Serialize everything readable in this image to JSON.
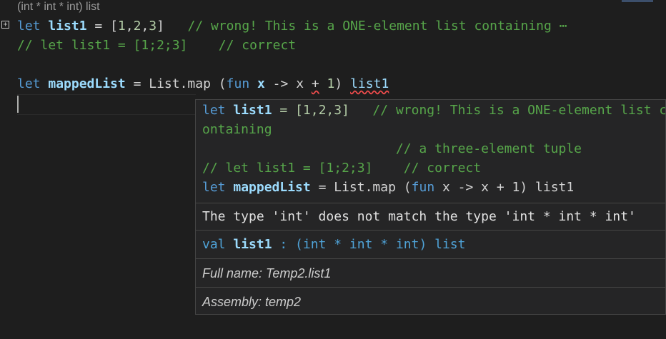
{
  "codelens": "(int * int * int) list",
  "editor": {
    "line1": {
      "kw": "let",
      "name": "list1",
      "eq": " = ",
      "bracket_open": "[",
      "n1": "1",
      "c1": ",",
      "n2": "2",
      "c2": ",",
      "n3": "3",
      "bracket_close": "]",
      "comment": "   // wrong! This is a ONE-element list containing",
      "ellipsis": " ⋯"
    },
    "line2": {
      "comment": "// let list1 = [1;2;3]    // correct"
    },
    "line4": {
      "kw": "let",
      "name": "mappedList",
      "eq": " = ",
      "fn": "List.map",
      "paren_open": " (",
      "fun_kw": "fun",
      "x1": " x ",
      "arrow": "->",
      "x2": " x ",
      "plus": "+",
      "one": " 1",
      "paren_close": ") ",
      "ref": "list1"
    }
  },
  "tooltip": {
    "code": {
      "line1_kw": "let",
      "line1_name": "list1",
      "line1_rest": " = [1,2,3]",
      "line1_comment": "   // wrong! This is a ONE-element list c",
      "line2": "ontaining",
      "line3": "                         // a three-element tuple",
      "line4": "// let list1 = [1;2;3]    // correct",
      "line5_kw": "let",
      "line5_name": "mappedList",
      "line5_eq": " = ",
      "line5_fn": "List.map",
      "line5_open": " (",
      "line5_fun": "fun",
      "line5_rest": " x -> x + 1) list1"
    },
    "error": "The type 'int' does not match the type 'int * int * int'",
    "signature": {
      "kw": "val",
      "name": "list1",
      "rest": " : (int * int * int) list"
    },
    "full_name": "Full name: Temp2.list1",
    "assembly": "Assembly: temp2"
  },
  "colors": {
    "background": "#1e1e1e",
    "keyword": "#569cd6",
    "comment": "#57a64a",
    "number": "#b5cea8",
    "error_squiggle": "#f14c4c",
    "tooltip_bg": "#252526"
  }
}
